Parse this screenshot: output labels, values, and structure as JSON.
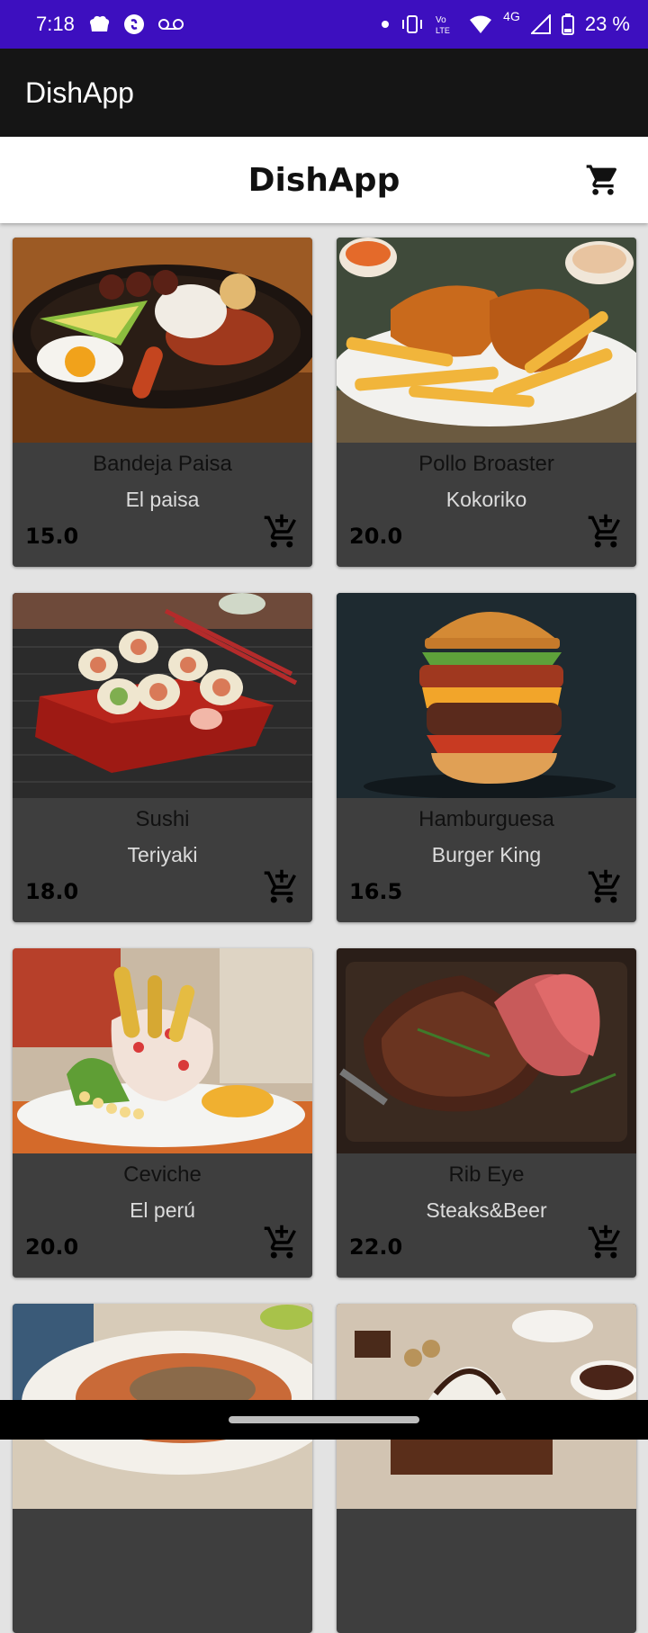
{
  "status_bar": {
    "time": "7:18",
    "battery": "23 %",
    "network": "4G",
    "icons": [
      "chef-hat-icon",
      "shazam-icon",
      "voicemail-icon",
      "dot-icon",
      "vibrate-icon",
      "volte-icon",
      "wifi-icon",
      "signal-icon",
      "battery-icon"
    ]
  },
  "app_bar": {
    "title": "DishApp"
  },
  "header": {
    "title": "DishApp",
    "cart_icon": "shopping-cart-icon"
  },
  "dishes": [
    {
      "name": "Bandeja Paisa",
      "restaurant": "El paisa",
      "price": "15.0",
      "image": "bandeja-paisa-photo"
    },
    {
      "name": "Pollo Broaster",
      "restaurant": "Kokoriko",
      "price": "20.0",
      "image": "fried-chicken-photo"
    },
    {
      "name": "Sushi",
      "restaurant": "Teriyaki",
      "price": "18.0",
      "image": "sushi-photo"
    },
    {
      "name": "Hamburguesa",
      "restaurant": "Burger King",
      "price": "16.5",
      "image": "burger-photo"
    },
    {
      "name": "Ceviche",
      "restaurant": "El perú",
      "price": "20.0",
      "image": "ceviche-photo"
    },
    {
      "name": "Rib Eye",
      "restaurant": "Steaks&Beer",
      "price": "22.0",
      "image": "steak-photo"
    },
    {
      "name": "",
      "restaurant": "",
      "price": "",
      "image": "fish-dish-photo"
    },
    {
      "name": "",
      "restaurant": "",
      "price": "",
      "image": "chocolate-dessert-photo"
    }
  ],
  "colors": {
    "status_bar": "#3d0fbf",
    "app_bar": "#151515",
    "card": "#3e3e3e",
    "background": "#e3e3e3"
  }
}
